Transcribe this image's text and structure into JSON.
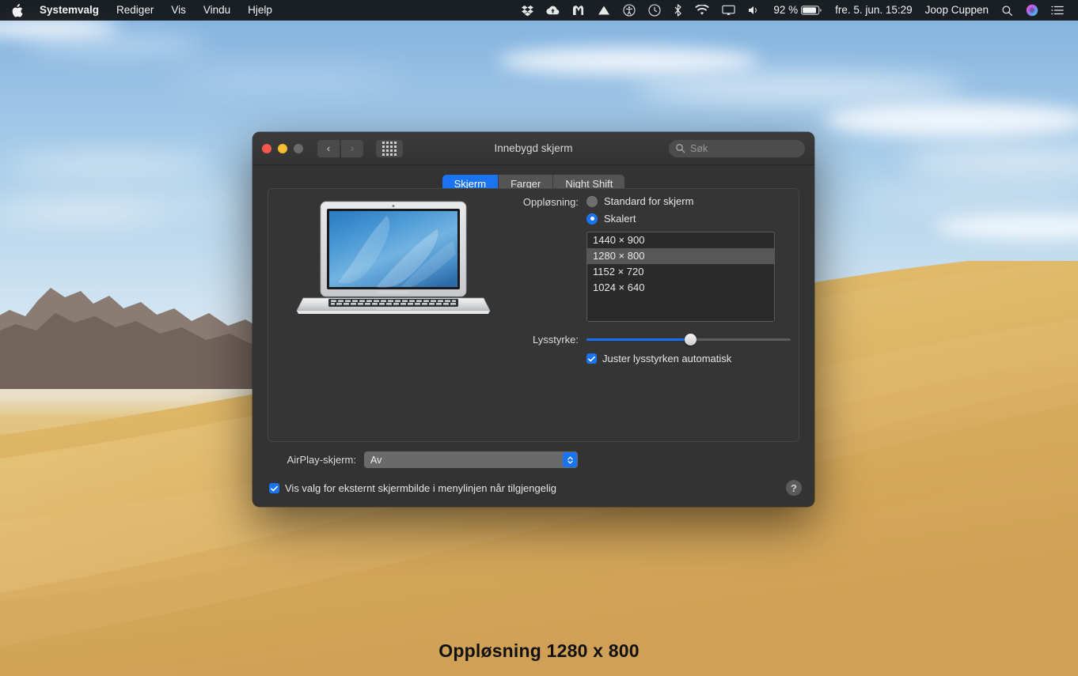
{
  "menubar": {
    "apple_icon": "apple-logo-icon",
    "items": [
      {
        "label": "Systemvalg",
        "bold": true
      },
      {
        "label": "Rediger",
        "bold": false
      },
      {
        "label": "Vis",
        "bold": false
      },
      {
        "label": "Vindu",
        "bold": false
      },
      {
        "label": "Hjelp",
        "bold": false
      }
    ],
    "status": {
      "dropbox_icon": "dropbox-icon",
      "cloud_icon": "cloud-upload-icon",
      "mail_icon": "m-app-icon",
      "triangle_icon": "triangle-vpn-icon",
      "accessibility_icon": "accessibility-icon",
      "timemachine_icon": "time-machine-icon",
      "bluetooth_icon": "bluetooth-icon",
      "wifi_icon": "wifi-icon",
      "airplay_icon": "airplay-display-icon",
      "volume_icon": "volume-icon",
      "battery_percent": "92 %",
      "battery_icon": "battery-icon",
      "datetime": "fre. 5. jun. 15:29",
      "user": "Joop Cuppen",
      "search_icon": "spotlight-search-icon",
      "siri_icon": "siri-icon",
      "notification_icon": "notification-center-icon"
    }
  },
  "window": {
    "title": "Innebygd skjerm",
    "traffic": {
      "close": "close-button",
      "minimize": "minimize-button",
      "zoom": "zoom-button"
    },
    "nav": {
      "back": "‹",
      "forward": "›"
    },
    "showall": "show-all-button",
    "search": {
      "placeholder": "Søk",
      "value": ""
    },
    "tabs": [
      {
        "label": "Skjerm",
        "active": true
      },
      {
        "label": "Farger",
        "active": false
      },
      {
        "label": "Night Shift",
        "active": false
      }
    ]
  },
  "display": {
    "laptop_illustration": "macbook-air-illustration",
    "resolution_label": "Oppløsning:",
    "radio_default": {
      "label": "Standard for skjerm",
      "selected": false
    },
    "radio_scaled": {
      "label": "Skalert",
      "selected": true
    },
    "resolutions": [
      {
        "label": "1440 × 900",
        "selected": false
      },
      {
        "label": "1280 × 800",
        "selected": true
      },
      {
        "label": "1152 × 720",
        "selected": false
      },
      {
        "label": "1024 × 640",
        "selected": false
      }
    ],
    "brightness_label": "Lysstyrke:",
    "brightness_percent": 51,
    "auto_brightness": {
      "label": "Juster lysstyrken automatisk",
      "checked": true
    }
  },
  "bottom": {
    "airplay_label": "AirPlay-skjerm:",
    "airplay_value": "Av",
    "mirroring_checkbox": {
      "label": "Vis valg for eksternt skjermbilde i menylinjen når tilgjengelig",
      "checked": true
    },
    "help_label": "?"
  },
  "overlay": {
    "caption": "Oppløsning 1280 x 800"
  },
  "colors": {
    "accent_blue": "#1a73f0",
    "window_bg": "#333333",
    "panel_bg": "#353535",
    "selected_row": "#575757",
    "sand": "#e0bd74",
    "sky": "#7fb0de"
  }
}
